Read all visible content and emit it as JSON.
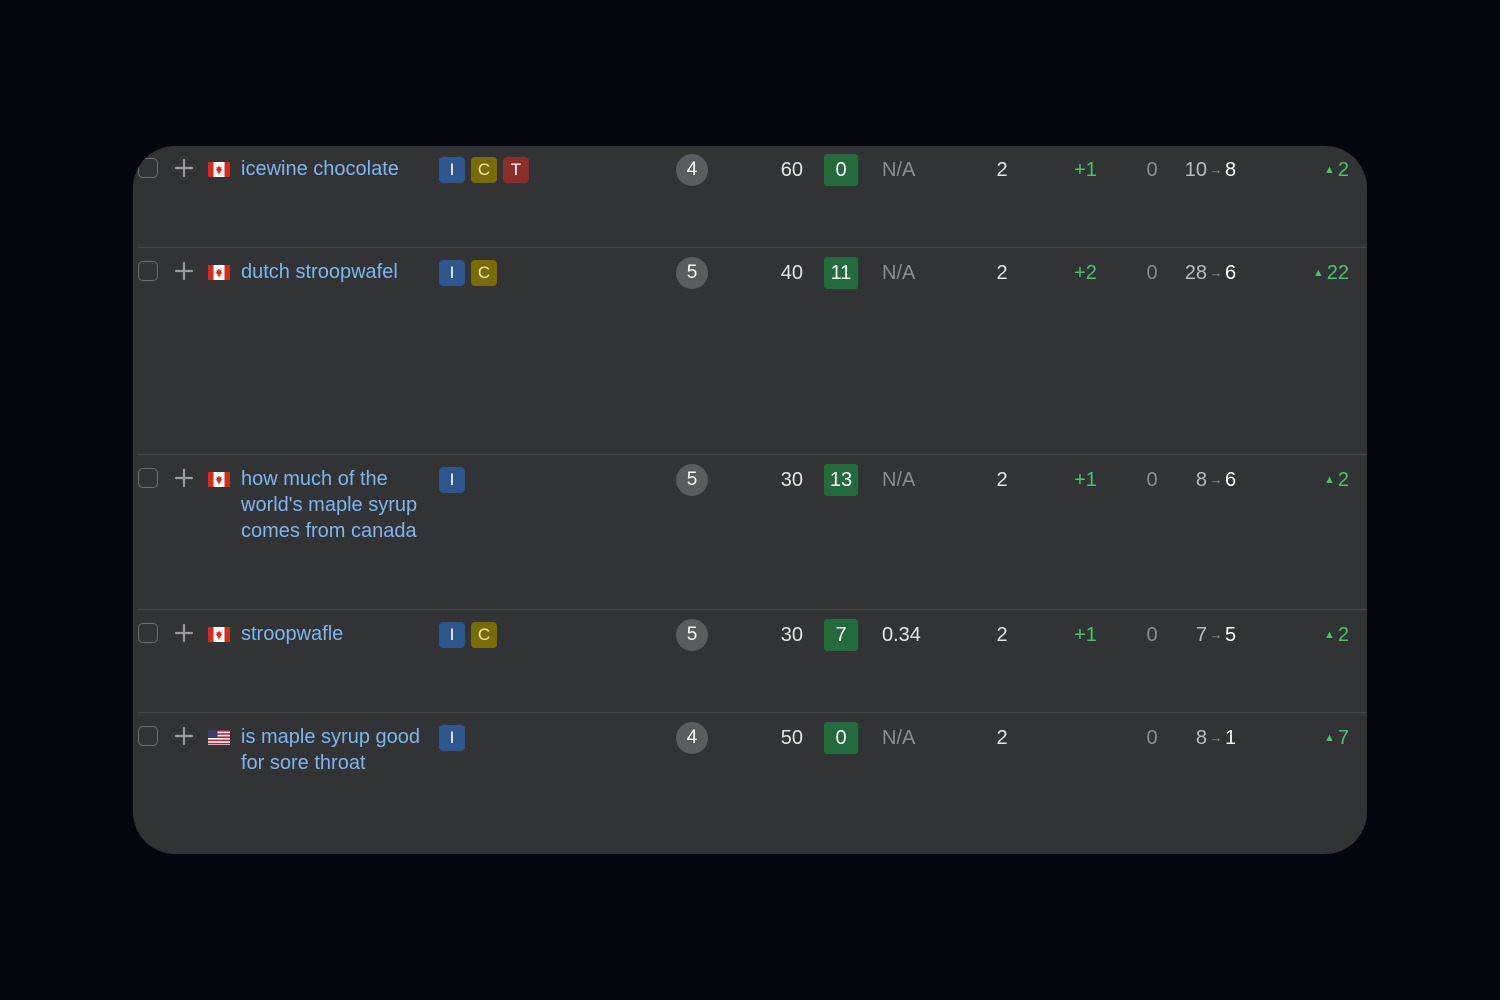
{
  "rows": [
    {
      "flag": "ca",
      "keyword": "icewine chocolate",
      "intents": [
        "I",
        "C",
        "T"
      ],
      "kd": "4",
      "volume": "60",
      "score": "0",
      "cpc": "N/A",
      "competition": "2",
      "gain": "+1",
      "zero": "0",
      "rank_from": "10",
      "rank_arrow": "→",
      "rank_to": "8",
      "trend_icon": "▲",
      "trend": "2"
    },
    {
      "flag": "ca",
      "keyword": "dutch stroopwafel",
      "intents": [
        "I",
        "C"
      ],
      "kd": "5",
      "volume": "40",
      "score": "11",
      "cpc": "N/A",
      "competition": "2",
      "gain": "+2",
      "zero": "0",
      "rank_from": "28",
      "rank_arrow": "→",
      "rank_to": "6",
      "trend_icon": "▲",
      "trend": "22"
    },
    {
      "flag": "ca",
      "keyword": "how much of the world's maple syrup comes from canada",
      "intents": [
        "I"
      ],
      "kd": "5",
      "volume": "30",
      "score": "13",
      "cpc": "N/A",
      "competition": "2",
      "gain": "+1",
      "zero": "0",
      "rank_from": "8",
      "rank_arrow": "→",
      "rank_to": "6",
      "trend_icon": "▲",
      "trend": "2"
    },
    {
      "flag": "ca",
      "keyword": "stroopwafle",
      "intents": [
        "I",
        "C"
      ],
      "kd": "5",
      "volume": "30",
      "score": "7",
      "cpc": "0.34",
      "competition": "2",
      "gain": "+1",
      "zero": "0",
      "rank_from": "7",
      "rank_arrow": "→",
      "rank_to": "5",
      "trend_icon": "▲",
      "trend": "2"
    },
    {
      "flag": "us",
      "keyword": "is maple syrup good for sore throat",
      "intents": [
        "I"
      ],
      "kd": "4",
      "volume": "50",
      "score": "0",
      "cpc": "N/A",
      "competition": "2",
      "gain": "",
      "zero": "0",
      "rank_from": "8",
      "rank_arrow": "→",
      "rank_to": "1",
      "trend_icon": "▲",
      "trend": "7"
    }
  ],
  "colors": {
    "background": "#05070f",
    "card": "#323335",
    "keyword_link": "#7db6ee",
    "positive": "#45c46a",
    "score_green": "#236b3c",
    "intent_I": "#2d568c",
    "intent_C": "#7a6b0a",
    "intent_T": "#8b2e2e"
  }
}
